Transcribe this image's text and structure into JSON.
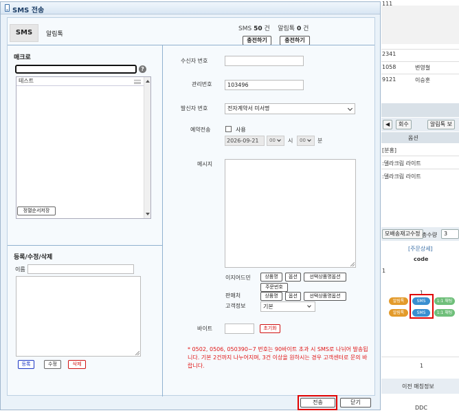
{
  "dialog": {
    "title": "SMS 전송",
    "tabs": [
      "SMS",
      "알림톡"
    ],
    "counter": {
      "sms_label": "SMS",
      "sms_count": "50",
      "sms_unit": "건",
      "alim_label": "알림톡",
      "alim_count": "0",
      "alim_unit": "건"
    },
    "charge_buttons": [
      "충전하기",
      "충전하기"
    ],
    "macro": {
      "title": "매크로",
      "search_value": "",
      "items": [
        "테스트"
      ],
      "sort_save_label": "정렬순서저장"
    },
    "register": {
      "title": "등록/수정/삭제",
      "name_label": "이름",
      "buttons": {
        "register": "등록",
        "edit": "수정",
        "delete": "삭제"
      }
    },
    "form": {
      "recipient_label": "수신자 번호",
      "recipient_value": "",
      "manage_label": "관리번호",
      "manage_value": "103496",
      "sender_label": "발신자 번호",
      "sender_value": "전자계약서 미서명",
      "reserve_label": "예약전송",
      "reserve_use": "사용",
      "reserve_checked": false,
      "date_value": "2026-09-21",
      "hour_value": "00",
      "hour_unit": "시",
      "minute_value": "00",
      "minute_unit": "분",
      "message_label": "메시지",
      "easy_admin_label": "이지어드민",
      "easy_admin_buttons": [
        "상품명",
        "옵션",
        "선택상품명옵션",
        "주문번호"
      ],
      "seller_label": "판매처",
      "seller_buttons": [
        "상품명",
        "옵션",
        "선택상품명옵션"
      ],
      "customer_label": "고객정보",
      "customer_value": "기본",
      "byte_label": "바이트",
      "reset_label": "초기화",
      "notice": "* 0502, 0506, 050390~7 번호는 90바이트 초과 시 SMS로 나뉘어 발송됩니다. 기본 2건까지 나누어지며, 3건 이상을 원하시는 경우 고객센터로 문의 바랍니다."
    },
    "footer": {
      "send": "전송",
      "close": "닫기"
    }
  },
  "background": {
    "top_value": "111",
    "rows": [
      {
        "id": "2341",
        "name": ""
      },
      {
        "id": "1058",
        "name": "변영철"
      },
      {
        "id": "9121",
        "name": "이승훈"
      }
    ],
    "toolbar": {
      "refund": "회수",
      "alimtalk": "알림톡 보"
    },
    "option_header": "옵션",
    "option_rows": [
      "[분홍]",
      ":델라크림 라이트",
      ":델라크림 라이트"
    ],
    "stock_button": "모배송재고수정",
    "total_label": "총수량",
    "total_value": "3",
    "detail_link": "[주문상세]",
    "code_header": "code",
    "code_row": "1",
    "code_value": "1",
    "pills": {
      "alim": "알림톡",
      "sms": "SMS",
      "chat": "1:1 채팅"
    },
    "bottom_value": "1",
    "prev_matching": "이전 매칭정보",
    "ddc": "DDC"
  }
}
